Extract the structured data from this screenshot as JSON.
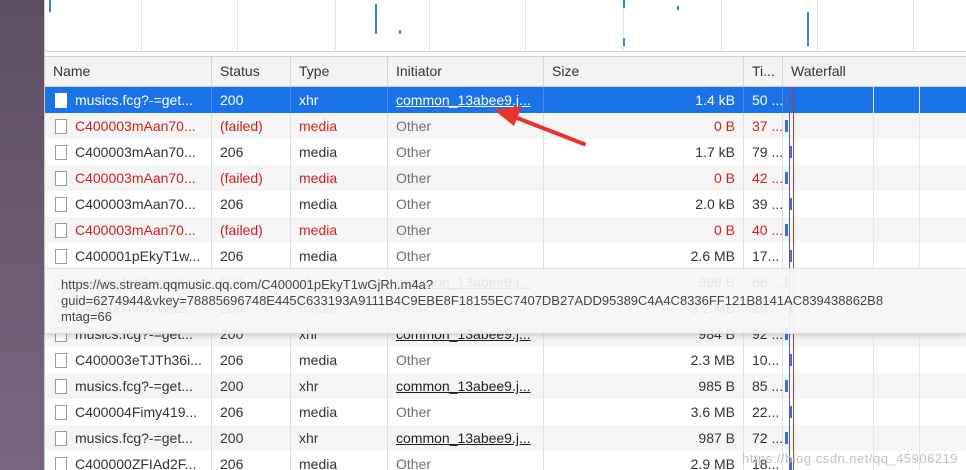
{
  "columns": {
    "name": "Name",
    "status": "Status",
    "type": "Type",
    "initiator": "Initiator",
    "size": "Size",
    "time": "Ti...",
    "waterfall": "Waterfall"
  },
  "rows": [
    {
      "name": "musics.fcg?-=get...",
      "status": "200",
      "type": "xhr",
      "initiator": "common_13abee9.j...",
      "initiator_link": true,
      "size": "1.4 kB",
      "time": "50 ...",
      "failed": false,
      "selected": true
    },
    {
      "name": "C400003mAan70...",
      "status": "(failed)",
      "type": "media",
      "initiator": "Other",
      "initiator_link": false,
      "size": "0 B",
      "time": "37 ...",
      "failed": true,
      "selected": false
    },
    {
      "name": "C400003mAan70...",
      "status": "206",
      "type": "media",
      "initiator": "Other",
      "initiator_link": false,
      "size": "1.7 kB",
      "time": "79 ...",
      "failed": false,
      "selected": false
    },
    {
      "name": "C400003mAan70...",
      "status": "(failed)",
      "type": "media",
      "initiator": "Other",
      "initiator_link": false,
      "size": "0 B",
      "time": "42 ...",
      "failed": true,
      "selected": false
    },
    {
      "name": "C400003mAan70...",
      "status": "206",
      "type": "media",
      "initiator": "Other",
      "initiator_link": false,
      "size": "2.0 kB",
      "time": "39 ...",
      "failed": false,
      "selected": false
    },
    {
      "name": "C400003mAan70...",
      "status": "(failed)",
      "type": "media",
      "initiator": "Other",
      "initiator_link": false,
      "size": "0 B",
      "time": "40 ...",
      "failed": true,
      "selected": false
    },
    {
      "name": "C400001pEkyT1w...",
      "status": "206",
      "type": "media",
      "initiator": "Other",
      "initiator_link": false,
      "size": "2.6 MB",
      "time": "17...",
      "failed": false,
      "selected": false
    },
    {
      "name": "musics.fcg?-=get...",
      "status": "200",
      "type": "xhr",
      "initiator": "common_13abee9.j...",
      "initiator_link": true,
      "size": "999 B",
      "time": "66 ...",
      "failed": false,
      "selected": false
    },
    {
      "name": "C400004fnWWd2...",
      "status": "206",
      "type": "media",
      "initiator": "Other",
      "initiator_link": false,
      "size": "3.2 MB",
      "time": "18...",
      "failed": false,
      "selected": false
    },
    {
      "name": "musics.fcg?-=get...",
      "status": "200",
      "type": "xhr",
      "initiator": "common_13abee9.j...",
      "initiator_link": true,
      "size": "984 B",
      "time": "92 ...",
      "failed": false,
      "selected": false
    },
    {
      "name": "C400003eTJTh36i...",
      "status": "206",
      "type": "media",
      "initiator": "Other",
      "initiator_link": false,
      "size": "2.3 MB",
      "time": "10...",
      "failed": false,
      "selected": false
    },
    {
      "name": "musics.fcg?-=get...",
      "status": "200",
      "type": "xhr",
      "initiator": "common_13abee9.j...",
      "initiator_link": true,
      "size": "985 B",
      "time": "85 ...",
      "failed": false,
      "selected": false
    },
    {
      "name": "C400004Fimy419...",
      "status": "206",
      "type": "media",
      "initiator": "Other",
      "initiator_link": false,
      "size": "3.6 MB",
      "time": "22...",
      "failed": false,
      "selected": false
    },
    {
      "name": "musics.fcg?-=get...",
      "status": "200",
      "type": "xhr",
      "initiator": "common_13abee9.j...",
      "initiator_link": true,
      "size": "987 B",
      "time": "72 ...",
      "failed": false,
      "selected": false
    },
    {
      "name": "C400000ZFIAd2F...",
      "status": "206",
      "type": "media",
      "initiator": "Other",
      "initiator_link": false,
      "size": "2.9 MB",
      "time": "18...",
      "failed": false,
      "selected": false
    }
  ],
  "tooltip": {
    "line1": "https://ws.stream.qqmusic.qq.com/C400001pEkyT1wGjRh.m4a?",
    "line2": "guid=6274944&vkey=78885696748E445C633193A9111B4C9EBE8F18155EC7407DB27ADD95389C4A4C8336FF121B8141AC839438862B8",
    "line3": "mtag=66"
  },
  "watermark": "https://blog.csdn.net/qq_45906219",
  "colors": {
    "selected_row": "#1a73e8",
    "failed_text": "#d21e1e",
    "annotation_arrow": "#e8342b"
  }
}
